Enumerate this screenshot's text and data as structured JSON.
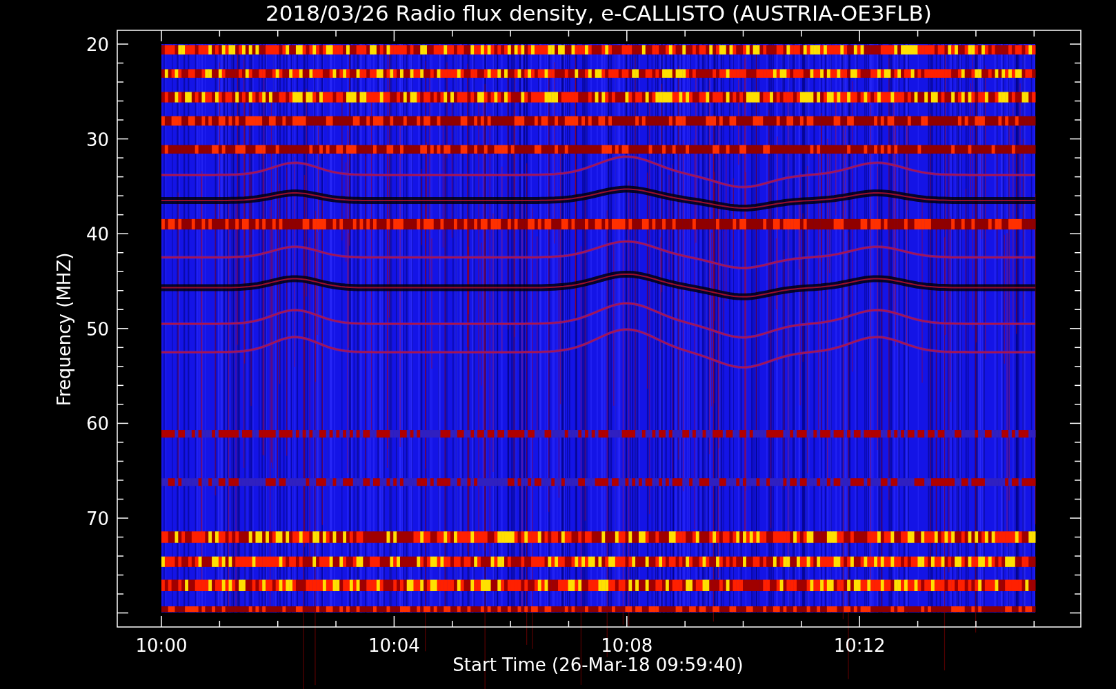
{
  "title": "2018/03/26  Radio flux density, e-CALLISTO (AUSTRIA-OE3FLB)",
  "y_axis": {
    "label": "Frequency (MHZ)",
    "ticks": [
      "20",
      "30",
      "40",
      "50",
      "60",
      "70"
    ]
  },
  "x_axis": {
    "label": "Start Time (26-Mar-18 09:59:40)",
    "ticks": [
      "10:00",
      "10:04",
      "10:08",
      "10:12"
    ]
  }
}
